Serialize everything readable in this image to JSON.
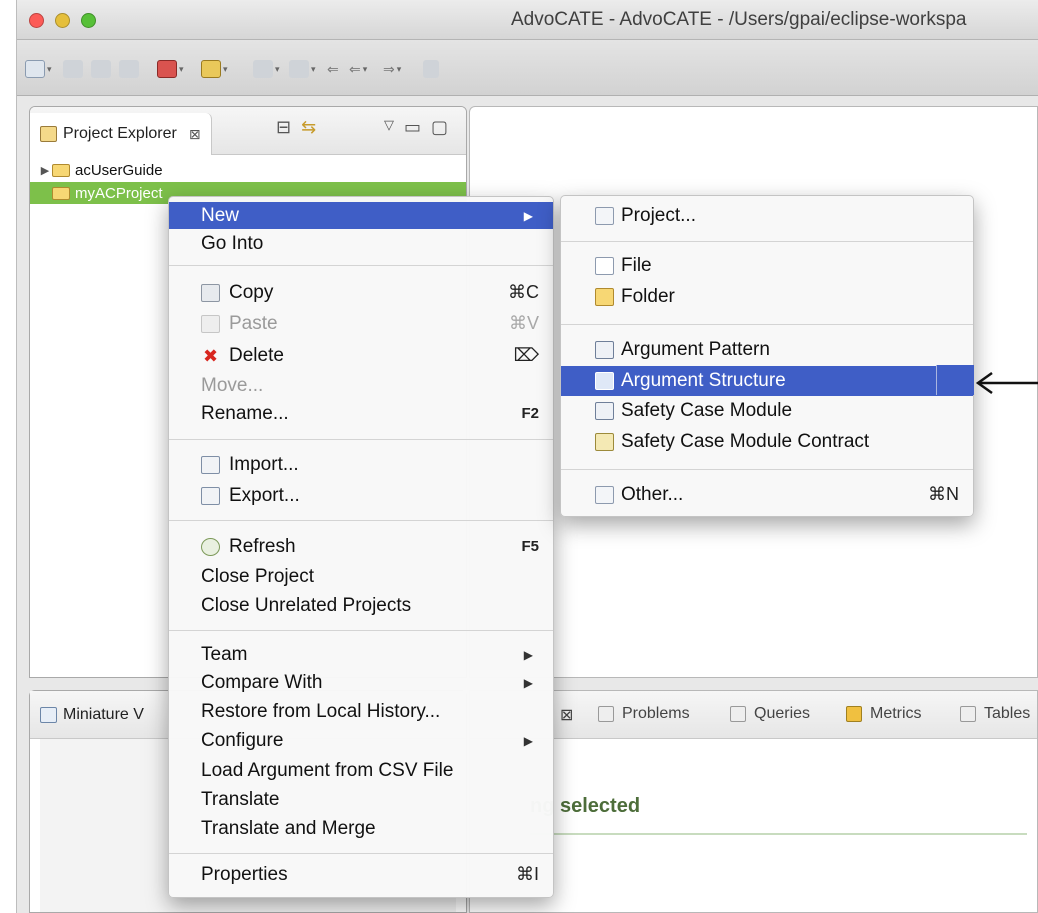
{
  "window": {
    "title": "AdvoCATE - AdvoCATE - /Users/gpai/eclipse-workspa",
    "colors": {
      "close": "#fc5b57",
      "minimize": "#e5bf3c",
      "zoom": "#57c038"
    }
  },
  "project_explorer": {
    "tab_label": "Project Explorer",
    "tab_close": "⊠",
    "items": [
      {
        "label": "acUserGuide",
        "icon": "folder-icon",
        "expanded": false
      },
      {
        "label": "myACProject",
        "icon": "open-folder-icon",
        "selected": true
      }
    ]
  },
  "miniature": {
    "tab_label": "Miniature V"
  },
  "properties": {
    "tab_close": "⊠",
    "tabs": [
      "Problems",
      "Queries",
      "Metrics",
      "Tables"
    ],
    "empty_message": "ng selected"
  },
  "context_menu": {
    "items": [
      {
        "label": "New",
        "submenu": true,
        "highlighted": true
      },
      {
        "label": "Go Into"
      },
      {
        "label": "Copy",
        "icon": "copy-icon",
        "shortcut": "⌘C"
      },
      {
        "label": "Paste",
        "icon": "paste-icon",
        "shortcut": "⌘V",
        "disabled": true
      },
      {
        "label": "Delete",
        "icon": "delete-icon",
        "shortcut": "⌦"
      },
      {
        "label": "Move...",
        "disabled": true
      },
      {
        "label": "Rename...",
        "shortcut": "F2"
      },
      {
        "label": "Import...",
        "icon": "import-icon"
      },
      {
        "label": "Export...",
        "icon": "export-icon"
      },
      {
        "label": "Refresh",
        "icon": "refresh-icon",
        "shortcut": "F5"
      },
      {
        "label": "Close Project"
      },
      {
        "label": "Close Unrelated Projects"
      },
      {
        "label": "Team",
        "submenu": true
      },
      {
        "label": "Compare With",
        "submenu": true
      },
      {
        "label": "Restore from Local History..."
      },
      {
        "label": "Configure",
        "submenu": true
      },
      {
        "label": "Load Argument from CSV File"
      },
      {
        "label": "Translate"
      },
      {
        "label": "Translate and Merge"
      },
      {
        "label": "Properties",
        "shortcut": "⌘I"
      }
    ]
  },
  "new_submenu": {
    "items": [
      {
        "label": "Project...",
        "icon": "new-project-icon"
      },
      {
        "label": "File",
        "icon": "new-file-icon"
      },
      {
        "label": "Folder",
        "icon": "new-folder-icon"
      },
      {
        "label": "Argument Pattern",
        "icon": "argument-pattern-icon"
      },
      {
        "label": "Argument Structure",
        "icon": "argument-structure-icon",
        "highlighted": true
      },
      {
        "label": "Safety Case Module",
        "icon": "safety-case-module-icon"
      },
      {
        "label": "Safety Case Module Contract",
        "icon": "module-contract-icon"
      },
      {
        "label": "Other...",
        "icon": "other-wizard-icon",
        "shortcut": "⌘N"
      }
    ]
  },
  "accent_colors": {
    "menu_highlight": "#3f5ec6",
    "tree_selection": "#7dc04a"
  }
}
